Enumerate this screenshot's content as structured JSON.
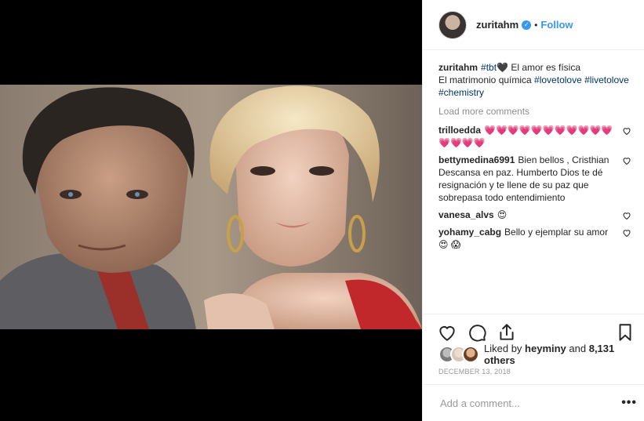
{
  "post": {
    "username": "zuritahm",
    "follow_label": "Follow",
    "dot": "•",
    "caption": {
      "username": "zuritahm",
      "tag1": "#tbt",
      "heart": "🖤",
      "text1": " El amor es física",
      "text2": "El matrimonio química ",
      "tag2": "#lovetolove",
      "tag3": "#livetolove",
      "tag4": "#chemistry"
    },
    "load_more": "Load more comments",
    "comments": [
      {
        "username": "trilloedda",
        "text": "💗💗💗💗💗💗💗💗💗💗💗💗💗💗💗"
      },
      {
        "username": "bettymedina6991",
        "text": "Bien bellos , Cristhian Descansa en paz. Humberto Dios te dé resignación y te llene de su paz que sobrepasa todo entendimiento"
      },
      {
        "username": "vanesa_alvs",
        "text": "😍"
      },
      {
        "username": "yohamy_cabg",
        "text": "Bello y ejemplar su amor😍 😱"
      }
    ],
    "likes": {
      "prefix": "Liked by ",
      "user": "heyminy",
      "mid": " and ",
      "count": "8,131 others"
    },
    "date": "DECEMBER 13, 2018",
    "add_comment_placeholder": "Add a comment...",
    "more_label": "•••"
  },
  "colors": {
    "link": "#003569",
    "follow": "#3897f0",
    "muted": "#8e8e8e"
  }
}
